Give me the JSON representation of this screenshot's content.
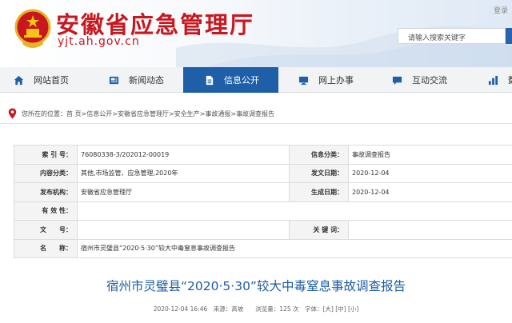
{
  "header": {
    "site_title": "安徽省应急管理厅",
    "site_domain": "yjt.ah.gov.cn",
    "login_link": "登录",
    "search_placeholder": "请输入搜索关键字",
    "emblem": "national-emblem"
  },
  "nav": {
    "items": [
      {
        "label": "网站首页",
        "icon": "home-icon"
      },
      {
        "label": "新闻动态",
        "icon": "news-icon"
      },
      {
        "label": "信息公开",
        "icon": "document-icon",
        "active": true
      },
      {
        "label": "网上办事",
        "icon": "monitor-icon"
      },
      {
        "label": "互动交流",
        "icon": "chat-icon"
      },
      {
        "label": "数",
        "icon": "chart-icon"
      }
    ]
  },
  "breadcrumb": {
    "prefix": "您所在的位置：",
    "items": [
      "首 页",
      "信息公开",
      "安徽省应急管理厅",
      "安全生产",
      "事故通报",
      "事故调查报告"
    ],
    "separator": " > "
  },
  "meta_table": {
    "rows": [
      {
        "k1": "索 引 号：",
        "v1": "76080338-3/202012-00019",
        "k2": "信息分类：",
        "v2": "事故调查报告"
      },
      {
        "k1": "内容分类：",
        "v1": "其他,市场监管、应急管理,2020年",
        "k2": "发文日期：",
        "v2": "2020-12-04"
      },
      {
        "k1": "发布机构：",
        "v1": "安徽省应急管理厅",
        "k2": "生成日期：",
        "v2": "2020-12-04"
      },
      {
        "k1": "有 效 性：",
        "v1": "",
        "k2": "",
        "v2": ""
      },
      {
        "k1": "文　　号：",
        "v1": "",
        "k2": "关 键 词：",
        "v2": ""
      },
      {
        "k1": "名　　称：",
        "v1": "宿州市灵璧县“2020·5·30”较大中毒窒息事故调查报告"
      }
    ]
  },
  "article": {
    "title": "宿州市灵璧县“2020·5·30”较大中毒窒息事故调查报告",
    "meta": "2020-12-04 16:46　来源：高坡　　浏览量：125 次　字体：[大] [中] [小]"
  },
  "colors": {
    "brand_red": "#c8171e",
    "nav_active": "#1e5fa8",
    "title_blue": "#1c5ca6"
  }
}
